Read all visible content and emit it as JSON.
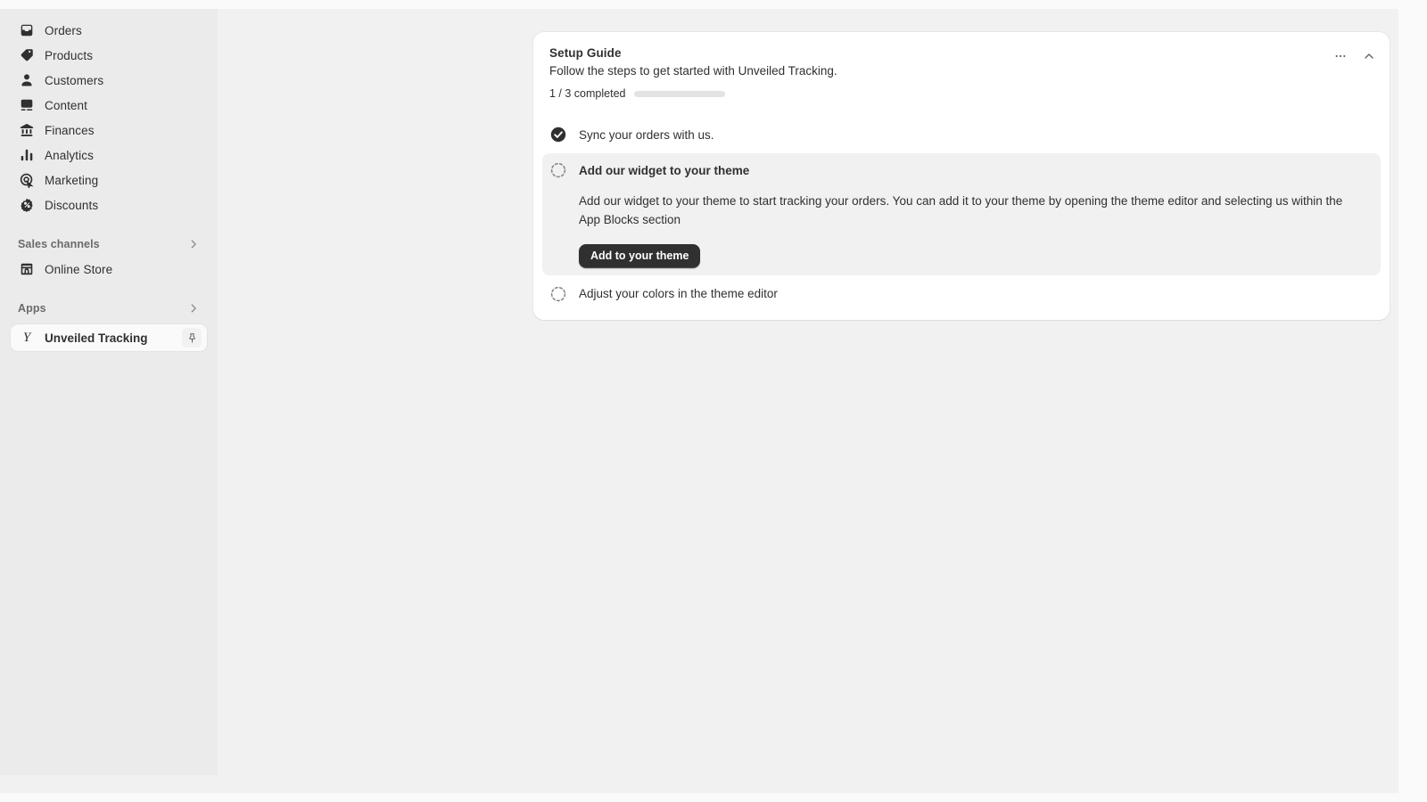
{
  "sidebar": {
    "nav_items": [
      {
        "label": "Orders",
        "icon": "orders-icon"
      },
      {
        "label": "Products",
        "icon": "tag-icon"
      },
      {
        "label": "Customers",
        "icon": "person-icon"
      },
      {
        "label": "Content",
        "icon": "content-icon"
      },
      {
        "label": "Finances",
        "icon": "bank-icon"
      },
      {
        "label": "Analytics",
        "icon": "bar-chart-icon"
      },
      {
        "label": "Marketing",
        "icon": "target-icon"
      },
      {
        "label": "Discounts",
        "icon": "discount-icon"
      }
    ],
    "sales_channels": {
      "title": "Sales channels",
      "items": [
        {
          "label": "Online Store",
          "icon": "storefront-icon"
        }
      ]
    },
    "apps": {
      "title": "Apps",
      "items": [
        {
          "label": "Unveiled Tracking",
          "logo": "Y",
          "pin": "pin-icon"
        }
      ]
    }
  },
  "card": {
    "title": "Setup Guide",
    "subtitle": "Follow the steps to get started with Unveiled Tracking.",
    "progress_label": "1 / 3 completed",
    "progress_completed": 1,
    "progress_total": 3,
    "progress_percent": 33,
    "more_icon": "ellipsis-icon",
    "collapse_icon": "chevron-up-icon",
    "steps": [
      {
        "label": "Sync your orders with us.",
        "state": "completed",
        "icon": "check-circle-icon"
      },
      {
        "label": "Add our widget to your theme",
        "state": "active",
        "icon": "dashed-circle-icon",
        "description": "Add our widget to your theme to start tracking your orders. You can add it to your theme by opening the theme editor and selecting us within the App Blocks section",
        "action_label": "Add to your theme"
      },
      {
        "label": "Adjust your colors in the theme editor",
        "state": "incomplete",
        "icon": "dashed-circle-icon"
      }
    ]
  },
  "colors": {
    "ink": "#303030",
    "surface": "#ffffff",
    "page_bg": "#f1f1f1",
    "sidebar_bg": "#ebebeb",
    "progress_fill": "#303030",
    "progress_track": "#e3e3e3"
  }
}
